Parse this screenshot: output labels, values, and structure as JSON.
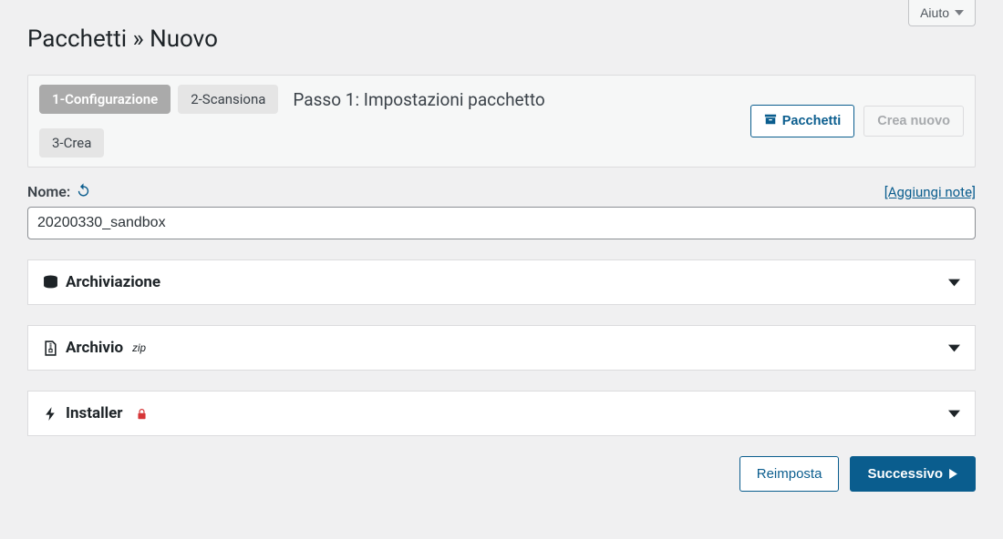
{
  "help_label": "Aiuto",
  "page_title": "Pacchetti » Nuovo",
  "steps": {
    "s1": "1-Configurazione",
    "s2": "2-Scansiona",
    "s3": "3-Crea",
    "heading": "Passo 1: Impostazioni pacchetto"
  },
  "buttons": {
    "packages": "Pacchetti",
    "create_new": "Crea nuovo",
    "reset": "Reimposta",
    "next": "Successivo"
  },
  "form": {
    "name_label": "Nome:",
    "name_value": "20200330_sandbox",
    "add_notes": "[Aggiungi note]"
  },
  "sections": {
    "storage": "Archiviazione",
    "archive": "Archivio",
    "archive_sup": "zip",
    "installer": "Installer"
  }
}
